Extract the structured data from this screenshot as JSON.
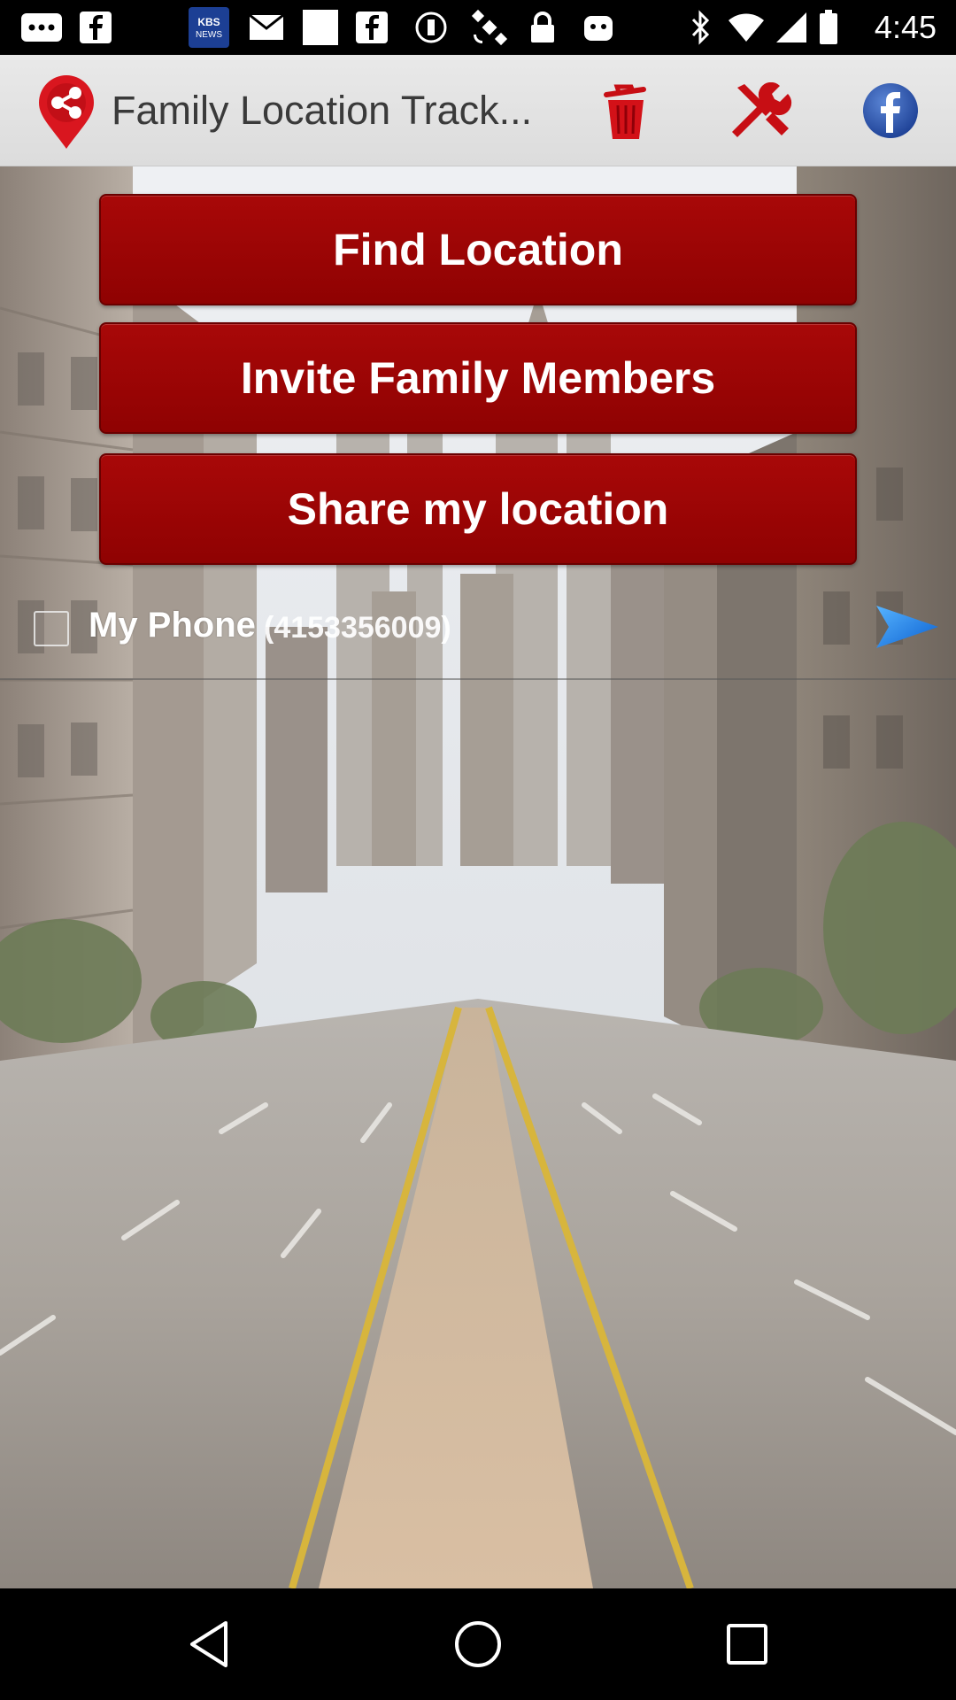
{
  "status_bar": {
    "time": "4:45",
    "icons": [
      "more-icon",
      "facebook-icon",
      "kbs-news-icon",
      "mail-icon",
      "square-icon",
      "facebook-icon",
      "circle-icon",
      "satellite-icon",
      "lock-icon",
      "android-icon",
      "bluetooth-icon",
      "wifi-icon",
      "signal-icon",
      "battery-icon"
    ]
  },
  "app_bar": {
    "title": "Family Location Track...",
    "actions": [
      "share-pin-icon",
      "trash-icon",
      "tools-icon",
      "facebook-icon"
    ]
  },
  "actions": {
    "find_location": "Find Location",
    "invite_family": "Invite Family Members",
    "share_location": "Share my location"
  },
  "contacts": [
    {
      "name": "My Phone",
      "number": "(4153356009)",
      "checked": false
    }
  ],
  "nav": {
    "buttons": [
      "back-icon",
      "home-icon",
      "recents-icon"
    ]
  },
  "colors": {
    "button_red": "#a80808",
    "app_bar_bg": "#e4e4e4",
    "accent_blue": "#1e7fe0"
  }
}
